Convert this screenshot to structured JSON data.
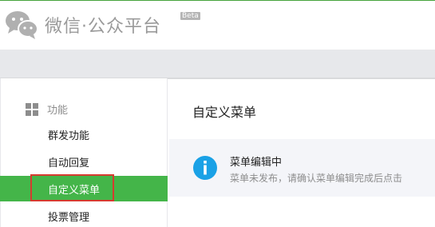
{
  "header": {
    "brand_text": "微信·公众平台",
    "beta_label": "Beta",
    "logo_icon": "wechat-logo-icon"
  },
  "sidebar": {
    "section_label": "功能",
    "section_icon": "grid-icon",
    "items": [
      {
        "label": "群发功能",
        "active": false
      },
      {
        "label": "自动回复",
        "active": false
      },
      {
        "label": "自定义菜单",
        "active": true
      },
      {
        "label": "投票管理",
        "active": false
      }
    ]
  },
  "main": {
    "title": "自定义菜单",
    "notice": {
      "icon": "info-icon",
      "title": "菜单编辑中",
      "description": "菜单未发布，请确认菜单编辑完成后点击"
    }
  },
  "colors": {
    "accent_green": "#44b549",
    "highlight_red": "#d53b2f",
    "info_blue": "#1aa1e6"
  }
}
